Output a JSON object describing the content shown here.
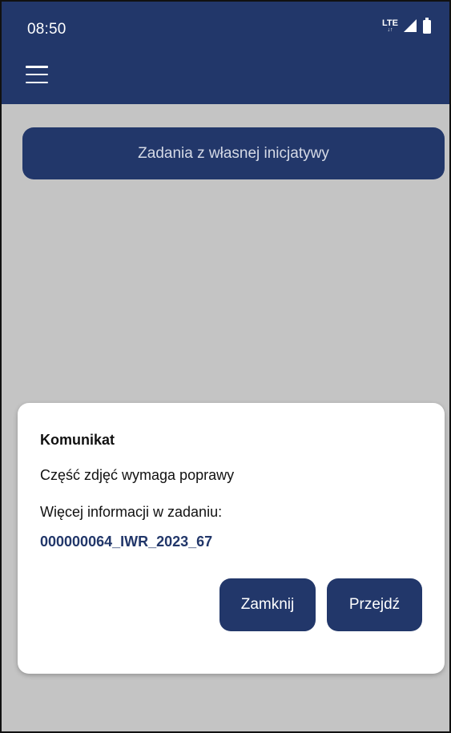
{
  "status_bar": {
    "time": "08:50",
    "network": "LTE",
    "icons": [
      "lte-icon",
      "signal-icon",
      "battery-icon"
    ]
  },
  "app_bar": {
    "menu_icon": "hamburger-menu-icon"
  },
  "main": {
    "banner_button_label": "Zadania z własnej inicjatywy"
  },
  "dialog": {
    "title": "Komunikat",
    "message": "Część zdjęć wymaga poprawy",
    "info_label": "Więcej informacji w zadaniu:",
    "task_link": "000000064_IWR_2023_67",
    "close_label": "Zamknij",
    "go_label": "Przejdź"
  },
  "colors": {
    "primary": "#22376a",
    "background": "#c4c4c4",
    "dialog": "#ffffff"
  }
}
